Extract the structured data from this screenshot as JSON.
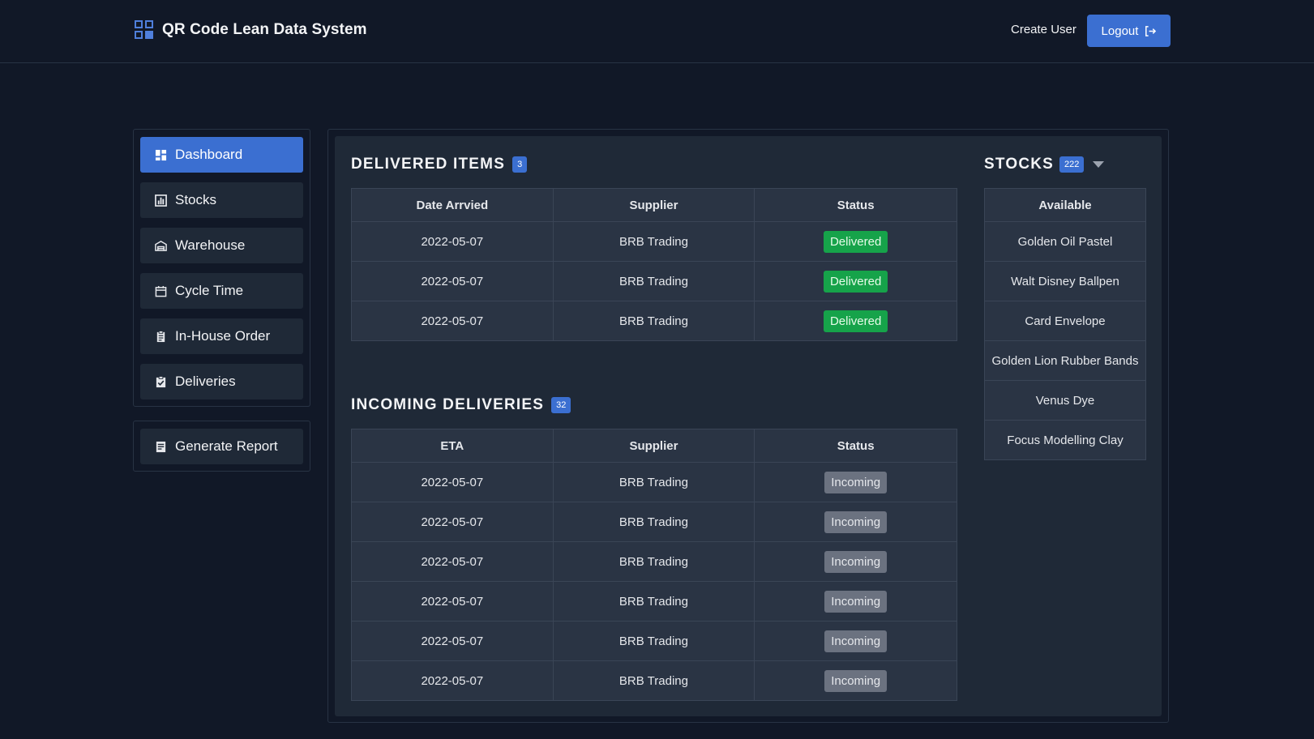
{
  "header": {
    "app_title": "QR Code Lean Data System",
    "create_user_label": "Create User",
    "logout_label": "Logout",
    "accent_color": "#3b6fd1"
  },
  "sidebar": {
    "items": [
      {
        "label": "Dashboard",
        "icon": "dashboard-icon",
        "active": true
      },
      {
        "label": "Stocks",
        "icon": "chart-icon",
        "active": false
      },
      {
        "label": "Warehouse",
        "icon": "warehouse-icon",
        "active": false
      },
      {
        "label": "Cycle Time",
        "icon": "calendar-icon",
        "active": false
      },
      {
        "label": "In-House Order",
        "icon": "clipboard-icon",
        "active": false
      },
      {
        "label": "Deliveries",
        "icon": "clipboard-check-icon",
        "active": false
      }
    ],
    "report_label": "Generate Report"
  },
  "delivered": {
    "title": "DELIVERED ITEMS",
    "count": "3",
    "columns": [
      "Date Arrvied",
      "Supplier",
      "Status"
    ],
    "rows": [
      {
        "date": "2022-05-07",
        "supplier": "BRB Trading",
        "status": "Delivered"
      },
      {
        "date": "2022-05-07",
        "supplier": "BRB Trading",
        "status": "Delivered"
      },
      {
        "date": "2022-05-07",
        "supplier": "BRB Trading",
        "status": "Delivered"
      }
    ],
    "status_color": "#16a34a"
  },
  "incoming": {
    "title": "INCOMING DELIVERIES",
    "count": "32",
    "columns": [
      "ETA",
      "Supplier",
      "Status"
    ],
    "rows": [
      {
        "date": "2022-05-07",
        "supplier": "BRB Trading",
        "status": "Incoming"
      },
      {
        "date": "2022-05-07",
        "supplier": "BRB Trading",
        "status": "Incoming"
      },
      {
        "date": "2022-05-07",
        "supplier": "BRB Trading",
        "status": "Incoming"
      },
      {
        "date": "2022-05-07",
        "supplier": "BRB Trading",
        "status": "Incoming"
      },
      {
        "date": "2022-05-07",
        "supplier": "BRB Trading",
        "status": "Incoming"
      },
      {
        "date": "2022-05-07",
        "supplier": "BRB Trading",
        "status": "Incoming"
      }
    ],
    "status_color": "#6b7280"
  },
  "stocks": {
    "title": "STOCKS",
    "count": "222",
    "column": "Available",
    "items": [
      "Golden Oil Pastel",
      "Walt Disney Ballpen",
      "Card Envelope",
      "Golden Lion Rubber Bands",
      "Venus Dye",
      "Focus Modelling Clay"
    ]
  }
}
